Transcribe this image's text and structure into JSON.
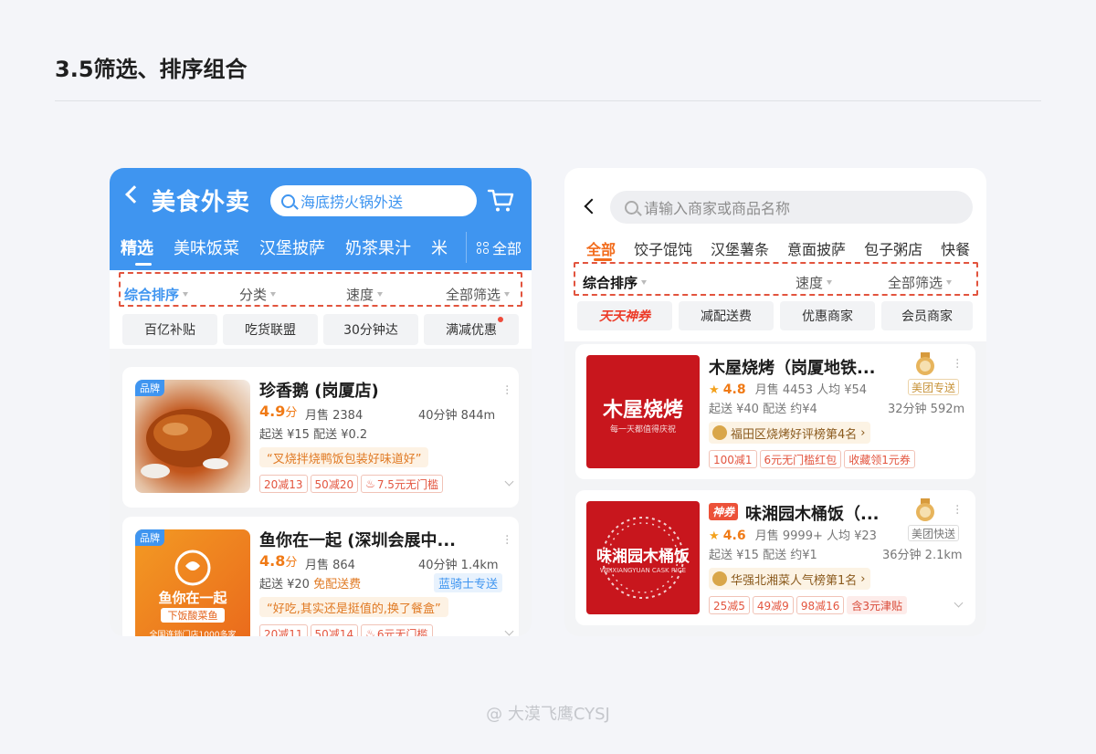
{
  "page": {
    "title": "3.5筛选、排序组合",
    "watermark": "@ 大漠飞鹰CYSJ"
  },
  "phone1": {
    "header": {
      "title": "美食外卖",
      "search_placeholder": "海底捞火锅外送",
      "accent": "#3f95f0"
    },
    "tabs": [
      "精选",
      "美味饭菜",
      "汉堡披萨",
      "奶茶果汁",
      "米"
    ],
    "all_label": "全部",
    "sort": [
      "综合排序",
      "分类",
      "速度",
      "全部筛选"
    ],
    "chips": [
      "百亿补贴",
      "吃货联盟",
      "30分钟达",
      "满减优惠"
    ],
    "cards": [
      {
        "badge": "品牌",
        "name": "珍香鹅 (岗厦店)",
        "rating": "4.9",
        "rating_unit": "分",
        "sales": "月售 2384",
        "distance": "40分钟 844m",
        "fees": "起送 ¥15  配送 ¥0.2",
        "promo": "“叉烧拌烧鸭饭包装好味道好”",
        "tags": [
          "20减13",
          "50减20",
          "7.5元无门槛"
        ]
      },
      {
        "badge": "品牌",
        "name": "鱼你在一起 (深圳会展中...",
        "rating": "4.8",
        "rating_unit": "分",
        "sales": "月售 864",
        "distance": "40分钟 1.4km",
        "fees": "起送 ¥20",
        "free_ship": "免配送费",
        "rider": "蓝骑士专送",
        "promo": "“好吃,其实还是挺值的,换了餐盒”",
        "tags": [
          "20减11",
          "50减14",
          "6元无门槛"
        ],
        "logo_text": "鱼你在一起",
        "logo_sub": "下饭酸菜鱼",
        "logo_foot": "全国连锁门店1000多家"
      }
    ]
  },
  "phone2": {
    "search_placeholder": "请输入商家或商品名称",
    "categories": [
      "全部",
      "饺子馄饨",
      "汉堡薯条",
      "意面披萨",
      "包子粥店",
      "快餐"
    ],
    "sort": [
      "综合排序",
      "速度",
      "全部筛选"
    ],
    "chips": [
      "天天神券",
      "减配送费",
      "优惠商家",
      "会员商家"
    ],
    "accent": "#f26c1c",
    "cards": [
      {
        "name": "木屋烧烤（岗厦地铁...",
        "rating": "4.8",
        "sales": "月售 4453  人均 ¥54",
        "fees": "起送 ¥40  配送 约¥4",
        "distance": "32分钟 592m",
        "delivery": "美团专送",
        "rank": "福田区烧烤好评榜第4名",
        "tags": [
          "100减1",
          "6元无门槛红包",
          "收藏领1元券"
        ],
        "logo_text": "木屋烧烤",
        "logo_sub": "每一天都值得庆祝"
      },
      {
        "badge": "神券",
        "name": "味湘园木桶饭（...",
        "rating": "4.6",
        "sales": "月售 9999+  人均 ¥23",
        "fees": "起送 ¥15  配送 约¥1",
        "distance": "36分钟 2.1km",
        "delivery": "美团快送",
        "rank": "华强北湘菜人气榜第1名",
        "tags": [
          "25减5",
          "49减9",
          "98减16",
          "含3元津贴"
        ],
        "logo_text": "味湘园木桶饭",
        "logo_sub": "WEIXIANGYUAN CASK RICE"
      }
    ]
  }
}
